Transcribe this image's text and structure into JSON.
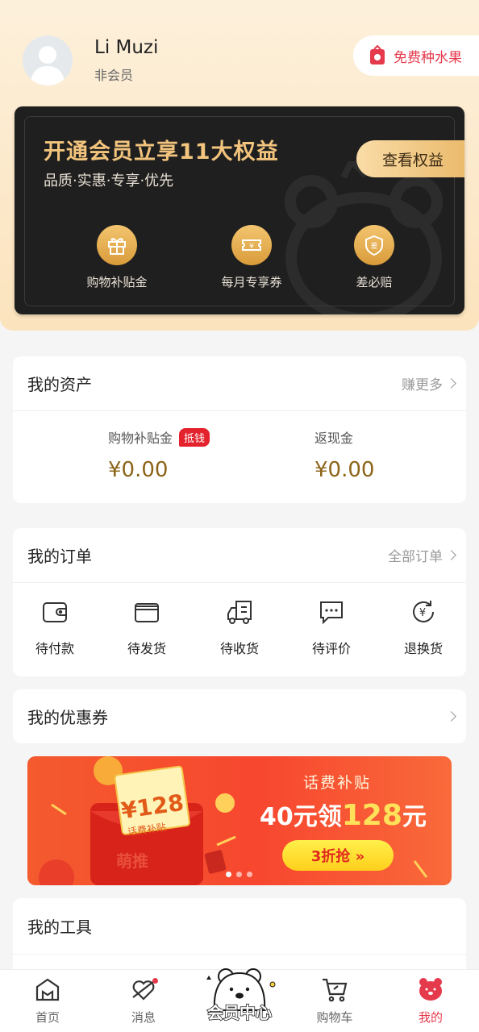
{
  "profile": {
    "username": "Li Muzi",
    "member_status": "非会员",
    "fruit_button": "免费种水果"
  },
  "member_card": {
    "title": "开通会员立享11大权益",
    "subtitle": "品质·实惠·专享·优先",
    "view_button": "查看权益",
    "benefits": [
      {
        "label": "购物补贴金",
        "icon": "gift-icon"
      },
      {
        "label": "每月专享券",
        "icon": "ticket-icon"
      },
      {
        "label": "差必赔",
        "icon": "shield-icon"
      }
    ]
  },
  "assets": {
    "title": "我的资产",
    "link": "赚更多",
    "items": [
      {
        "label": "购物补贴金",
        "tag": "抵钱",
        "value": "¥0.00"
      },
      {
        "label": "返现金",
        "value": "¥0.00"
      }
    ]
  },
  "orders": {
    "title": "我的订单",
    "link": "全部订单",
    "items": [
      {
        "label": "待付款",
        "icon": "wallet-icon"
      },
      {
        "label": "待发货",
        "icon": "box-icon"
      },
      {
        "label": "待收货",
        "icon": "truck-icon"
      },
      {
        "label": "待评价",
        "icon": "chat-icon"
      },
      {
        "label": "退换货",
        "icon": "refund-icon"
      }
    ]
  },
  "coupons": {
    "title": "我的优惠券"
  },
  "banner": {
    "heading": "话费补贴",
    "offer_prefix": "40元领",
    "offer_highlight": "128",
    "offer_suffix": "元",
    "cta": "3折抢 »",
    "ticket_value": "¥128",
    "ticket_label": "话费补贴",
    "envelope_text": "萌推",
    "slide_count": 3,
    "active_slide": 1
  },
  "tools": {
    "title": "我的工具"
  },
  "tabbar": {
    "items": [
      {
        "label": "首页",
        "icon": "home-icon"
      },
      {
        "label": "消息",
        "icon": "message-icon",
        "unread_dot": true
      },
      {
        "label": "会员中心",
        "icon": "bear-mascot-icon"
      },
      {
        "label": "购物车",
        "icon": "cart-icon"
      },
      {
        "label": "我的",
        "icon": "bear-profile-icon",
        "active": true
      }
    ]
  },
  "colors": {
    "accent_red": "#e53a4c",
    "gold": "#f2c47d",
    "asset_value": "#8c6418"
  }
}
